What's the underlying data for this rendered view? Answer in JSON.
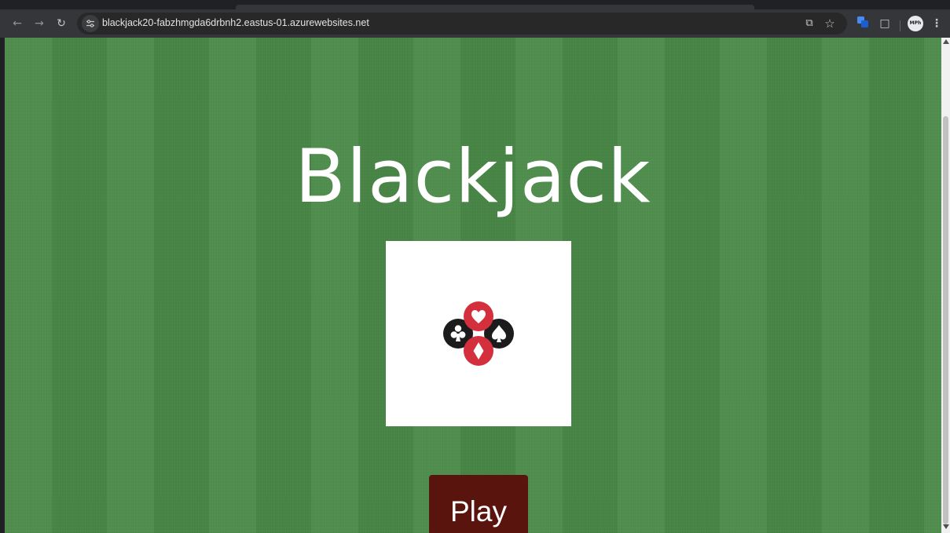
{
  "browser": {
    "url": "blackjack20-fabzhmgda6drbnh2.eastus-01.azurewebsites.net",
    "profile_label": "MPh",
    "icons": [
      "back-arrow-icon",
      "forward-arrow-icon",
      "reload-icon",
      "site-info-icon",
      "install-app-icon",
      "bookmark-star-icon",
      "translate-extension-icon",
      "extensions-puzzle-icon",
      "kebab-menu-icon"
    ]
  },
  "page": {
    "title": "Blackjack",
    "play_label": "Play",
    "logo_icon": "card-suits-logo-icon",
    "colors": {
      "felt_green": "#4a8a48",
      "play_button": "#5a140e",
      "suit_red": "#d32f3c",
      "suit_black": "#1c1c1c",
      "title_text": "#ffffff"
    }
  }
}
